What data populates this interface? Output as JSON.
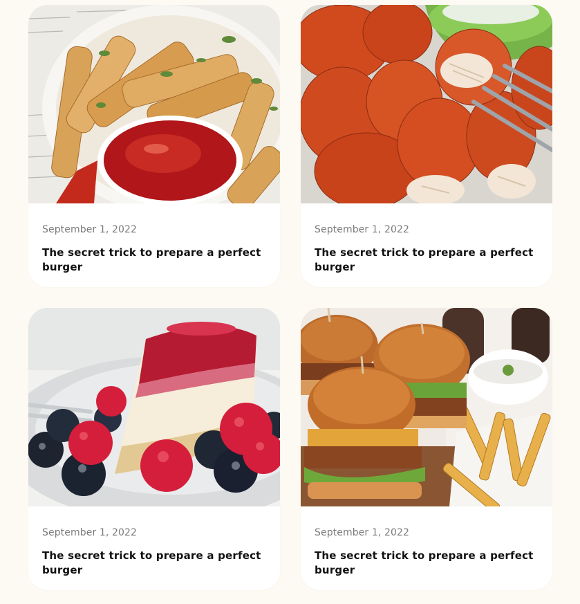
{
  "cards": [
    {
      "date": "September 1, 2022",
      "title": "The secret trick to prepare a perfect burger",
      "image": "fries-with-ketchup"
    },
    {
      "date": "September 1, 2022",
      "title": "The secret trick to prepare a perfect burger",
      "image": "fried-chicken-tenders"
    },
    {
      "date": "September 1, 2022",
      "title": "The secret trick to prepare a perfect burger",
      "image": "cheesecake-with-berries"
    },
    {
      "date": "September 1, 2022",
      "title": "The secret trick to prepare a perfect burger",
      "image": "burgers-and-fries"
    }
  ],
  "colors": {
    "page_background": "#fdf9f3",
    "card_background": "#ffffff",
    "date_text": "#7a7a7a",
    "title_text": "#111111"
  }
}
